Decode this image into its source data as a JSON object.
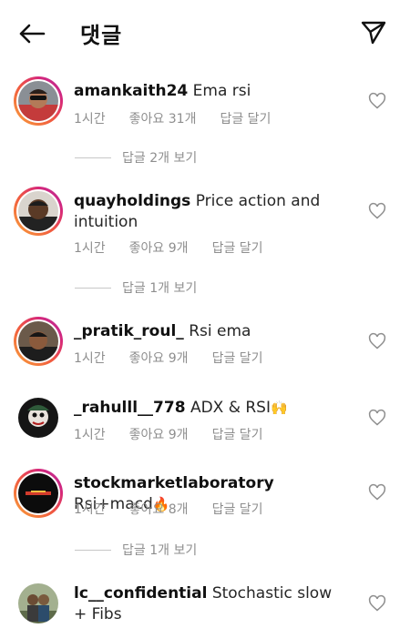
{
  "header": {
    "title": "댓글",
    "back_icon": "arrow-left-icon",
    "send_icon": "paper-plane-icon"
  },
  "comments": [
    {
      "username": "amankaith24",
      "text": "Ema rsi",
      "time": "1시간",
      "likes": "좋아요 31개",
      "reply": "답글 달기",
      "view_replies": "답글 2개 보기"
    },
    {
      "username": "quayholdings",
      "text": "Price action and intuition",
      "time": "1시간",
      "likes": "좋아요 9개",
      "reply": "답글 달기",
      "view_replies": "답글 1개 보기"
    },
    {
      "username": "_pratik_roul_",
      "text": "Rsi ema",
      "time": "1시간",
      "likes": "좋아요 9개",
      "reply": "답글 달기"
    },
    {
      "username": "_rahulll__778",
      "text": "ADX & RSI",
      "emoji": "🙌",
      "time": "1시간",
      "likes": "좋아요 9개",
      "reply": "답글 달기"
    },
    {
      "username": "stockmarketlaboratory",
      "text": "Rsi+macd",
      "emoji": "🔥",
      "time": "1시간",
      "likes": "좋아요 8개",
      "reply": "답글 달기",
      "view_replies": "답글 1개 보기"
    },
    {
      "username": "lc__confidential",
      "text": "Stochastic slow + Fibs"
    }
  ]
}
